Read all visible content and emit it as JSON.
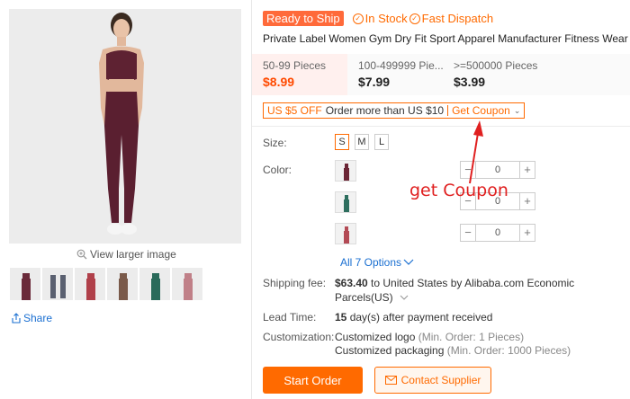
{
  "gallery": {
    "view_larger": "View larger image",
    "share": "Share",
    "thumbnail_colors": [
      "#6a2a3a",
      "#5a6070",
      "#b0404a",
      "#7a5a4a",
      "#2a6a5a",
      "#c08088"
    ]
  },
  "product": {
    "badges": {
      "ready": "Ready to Ship",
      "in_stock": "In Stock",
      "fast_dispatch": "Fast Dispatch"
    },
    "title": "Private Label Women Gym Dry Fit Sport Apparel Manufacturer Fitness Wear",
    "tiers": [
      {
        "qty": "50-99 Pieces",
        "price": "$8.99"
      },
      {
        "qty": "100-499999 Pie...",
        "price": "$7.99"
      },
      {
        "qty": ">=500000 Pieces",
        "price": "$3.99"
      }
    ],
    "coupon": {
      "off": "US $5 OFF",
      "condition": "Order more than US $10",
      "get": "Get Coupon"
    },
    "size_label": "Size:",
    "sizes": [
      "S",
      "M",
      "L"
    ],
    "color_label": "Color:",
    "swatch_colors": [
      "#6b2535",
      "#2d6e5e",
      "#b34a55"
    ],
    "quantities": [
      "0",
      "0",
      "0"
    ],
    "all_options": "All 7 Options",
    "shipping_label": "Shipping fee:",
    "shipping_price": "$63.40",
    "shipping_text": " to United States by Alibaba.com Economic",
    "shipping_method": "Parcels(US)",
    "lead_label": "Lead Time:",
    "lead_days": "15",
    "lead_text": " day(s) after payment received",
    "custom_label": "Customization:",
    "custom_logo": "Customized logo",
    "custom_logo_min": " (Min. Order: 1 Pieces)",
    "custom_pack": "Customized packaging",
    "custom_pack_min": " (Min. Order: 1000 Pieces)",
    "start_order": "Start Order",
    "contact": "Contact Supplier"
  },
  "annotation": {
    "text": "get Coupon",
    "color": "#e02020"
  },
  "colors": {
    "accent": "#ff6a00",
    "link": "#1a6fd1",
    "ready_bg": "#ff6a3a"
  }
}
